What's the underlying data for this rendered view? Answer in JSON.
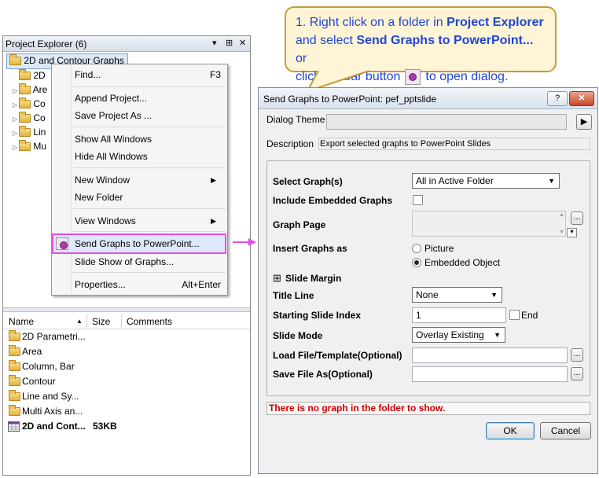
{
  "callout": {
    "line1_prefix": "1. Right click on a folder in ",
    "line1_bold": "Project Explorer",
    "line2_prefix": "and select ",
    "line2_bold": "Send Graphs to PowerPoint...",
    "line2_suffix": " or",
    "line3_prefix": "click toolbar button",
    "line3_suffix": "to open dialog."
  },
  "project_explorer": {
    "title": "Project Explorer (6)",
    "pin": "▾",
    "dock": "⊞",
    "close": "✕",
    "root": "2D and Contour Graphs",
    "tree_items": [
      "2D",
      "Are",
      "Co",
      "Co",
      "Lin",
      "Mu"
    ],
    "columns": {
      "name": "Name",
      "size": "Size",
      "comments": "Comments",
      "sort_arrow": "▲"
    },
    "rows": [
      {
        "name": "2D Parametri...",
        "size": "",
        "icon": "folder-icon"
      },
      {
        "name": "Area",
        "size": "",
        "icon": "folder-icon"
      },
      {
        "name": "Column, Bar",
        "size": "",
        "icon": "folder-icon"
      },
      {
        "name": "Contour",
        "size": "",
        "icon": "folder-icon"
      },
      {
        "name": "Line and Sy...",
        "size": "",
        "icon": "folder-icon"
      },
      {
        "name": "Multi Axis an...",
        "size": "",
        "icon": "folder-icon"
      },
      {
        "name": "2D and Cont...",
        "size": "53KB",
        "icon": "project-file-icon"
      }
    ]
  },
  "context_menu": {
    "find": "Find...",
    "find_key": "F3",
    "append": "Append Project...",
    "save_as": "Save Project As ...",
    "show_all": "Show All Windows",
    "hide_all": "Hide All Windows",
    "new_window": "New Window",
    "new_folder": "New Folder",
    "view_windows": "View Windows",
    "send_graphs": "Send Graphs to PowerPoint...",
    "slide_show": "Slide Show of Graphs...",
    "properties": "Properties...",
    "properties_key": "Alt+Enter"
  },
  "dialog": {
    "title": "Send Graphs to PowerPoint: pef_pptslide",
    "help_btn": "?",
    "min_btn": "▬",
    "close_btn": "✕",
    "theme_label": "Dialog Theme",
    "theme_value": "",
    "theme_arrow": "▶",
    "description_label": "Description",
    "description_text": "Export selected graphs to PowerPoint Slides",
    "select_graphs_label": "Select Graph(s)",
    "select_graphs_value": "All in Active Folder",
    "include_embedded_label": "Include Embedded Graphs",
    "graph_page_label": "Graph Page",
    "insert_as_label": "Insert Graphs as",
    "radio_picture": "Picture",
    "radio_embedded": "Embedded Object",
    "slide_margin_toggle": "⊞",
    "slide_margin_label": "Slide Margin",
    "title_line_label": "Title Line",
    "title_line_value": "None",
    "start_index_label": "Starting Slide Index",
    "start_index_value": "1",
    "end_label": "End",
    "slide_mode_label": "Slide Mode",
    "slide_mode_value": "Overlay Existing",
    "load_file_label": "Load File/Template(Optional)",
    "load_file_value": "",
    "save_file_label": "Save File As(Optional)",
    "save_file_value": "",
    "browse": "...",
    "status_message": "There is no graph in the folder to show.",
    "ok": "OK",
    "cancel": "Cancel"
  },
  "colors": {
    "callout_text": "#1f45d8",
    "callout_border": "#c89a3a",
    "highlight": "#e64ee6",
    "status_red": "#d00000"
  }
}
